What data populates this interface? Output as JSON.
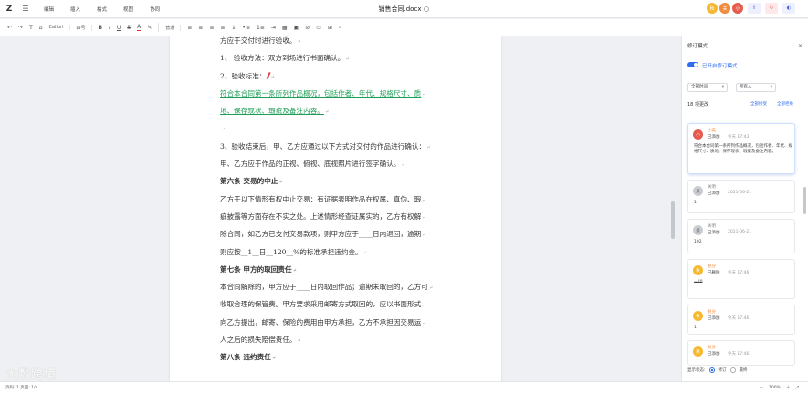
{
  "app": {
    "menu": [
      "编辑",
      "插入",
      "格式",
      "视图",
      "协同"
    ],
    "doc_title": "销售合同.docx"
  },
  "toolbar": {
    "font": "Calibri",
    "size": "四号",
    "style": "普通"
  },
  "document": {
    "lines": [
      {
        "text": "方应于交付时进行验收。",
        "style": "normal"
      },
      {
        "text": "1、 验收方法：双方到场进行书面确认。",
        "style": "normal"
      },
      {
        "text": "2、验收标准：",
        "style": "normal"
      },
      {
        "text": "符合本合同第一条所列作品概况，包括作者、年代、规格尺寸、质",
        "style": "ins"
      },
      {
        "text": "地、保存现状、瑕疵及备注内容。",
        "style": "ins"
      },
      {
        "text": "",
        "style": "normal"
      },
      {
        "text": "3、验收结束后，甲、乙方应通过以下方式对交付的作品进行确认：",
        "style": "normal"
      },
      {
        "text": "甲、乙方应于作品的正视、俯视、底视照片进行签字确认。",
        "style": "normal"
      },
      {
        "text": "第六条 交易的中止",
        "style": "bold"
      },
      {
        "text": "乙方于以下情形有权中止交易：有证据表明作品在权属、真伪、瑕",
        "style": "normal"
      },
      {
        "text": "疵披露等方面存在不实之处。上述情形经查证属实的，乙方有权解",
        "style": "normal"
      },
      {
        "text": "除合同，如乙方已支付交易款项，则甲方应于____日内退回，逾期",
        "style": "normal"
      },
      {
        "text": "则应按__1__日__120__%的标准承担违约金。",
        "style": "normal"
      },
      {
        "text": "第七条 甲方的取回责任",
        "style": "bold"
      },
      {
        "text": "本合同解除的，甲方应于____日内取回作品；逾期未取回的，乙方可",
        "style": "normal"
      },
      {
        "text": "收取合理的保管费。甲方要求采用邮寄方式取回的，应以书面形式",
        "style": "normal"
      },
      {
        "text": "向乙方提出，邮寄、保险的费用由甲方承担，乙方不承担因交易运",
        "style": "normal"
      },
      {
        "text": "人之后的损失赔偿责任。",
        "style": "normal"
      },
      {
        "text": "第八条 违约责任",
        "style": "bold"
      }
    ]
  },
  "panel": {
    "title": "修订模式",
    "toggle_label": "已开启修订模式",
    "filter_time": "全部时间",
    "filter_people": "所有人",
    "count": "18 项更改",
    "accept_all": "全部接受",
    "reject_all": "全部拒绝",
    "cards": [
      {
        "name": "小奕",
        "action": "已添加",
        "time": "今天 17:43",
        "body": "符合本合同第一条所列作品概况，包括作者、年代、规格尺寸、质地、保存现状、瑕疵及备注内容。",
        "avatar": "小",
        "color": "red"
      },
      {
        "name": "关明",
        "action": "已添加",
        "time": "2021-06-21",
        "body": "1",
        "avatar": "关",
        "color": "gray"
      },
      {
        "name": "关明",
        "action": "已添加",
        "time": "2021-06-21",
        "body": "102",
        "avatar": "关",
        "color": "gray"
      },
      {
        "name": "秋分",
        "action": "已删除",
        "time": "今天 17:46",
        "body": "=20",
        "avatar": "秋",
        "color": "yellow"
      },
      {
        "name": "秋分",
        "action": "已添加",
        "time": "今天 17:46",
        "body": "1",
        "avatar": "秋",
        "color": "yellow"
      },
      {
        "name": "秋分",
        "action": "已添加",
        "time": "今天 17:46",
        "body": "",
        "avatar": "秋",
        "color": "yellow"
      }
    ],
    "show_status_label": "显示状态:",
    "opt_revise": "修订",
    "opt_final": "最终"
  },
  "statusbar": {
    "left": "页码: 1  页面: 1/4",
    "zoom": "100%"
  },
  "watermark": "大数跨境"
}
